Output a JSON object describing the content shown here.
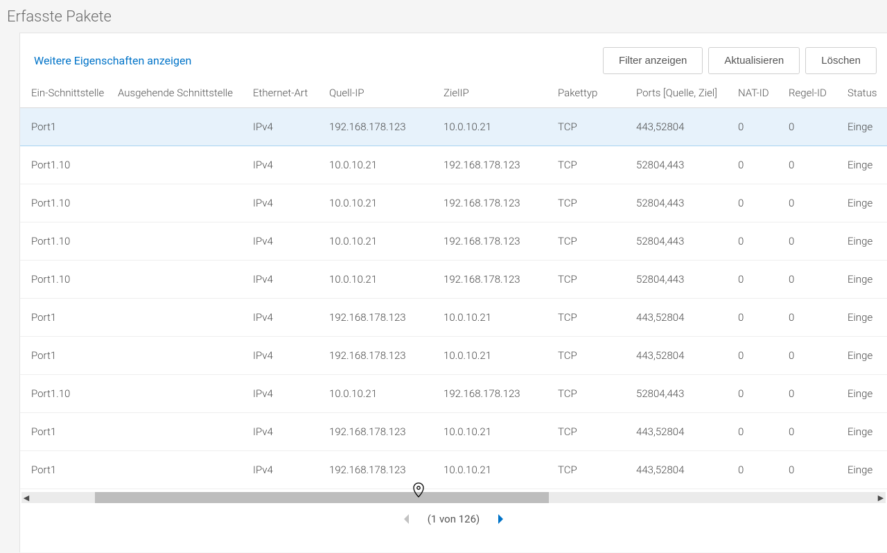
{
  "title": "Erfasste Pakete",
  "toolbar": {
    "more_props_link": "Weitere Eigenschaften anzeigen",
    "show_filter_btn": "Filter anzeigen",
    "refresh_btn": "Aktualisieren",
    "delete_btn": "Löschen"
  },
  "columns": [
    "Ein-Schnittstelle",
    "Ausgehende Schnittstelle",
    "Ethernet-Art",
    "Quell-IP",
    "ZielIP",
    "Pakettyp",
    "Ports [Quelle, Ziel]",
    "NAT-ID",
    "Regel-ID",
    "Status"
  ],
  "rows": [
    {
      "in": "Port1",
      "out": "",
      "eth": "IPv4",
      "src": "192.168.178.123",
      "dst": "10.0.10.21",
      "ptype": "TCP",
      "ports": "443,52804",
      "nat": "0",
      "rule": "0",
      "status": "Einge"
    },
    {
      "in": "Port1.10",
      "out": "",
      "eth": "IPv4",
      "src": "10.0.10.21",
      "dst": "192.168.178.123",
      "ptype": "TCP",
      "ports": "52804,443",
      "nat": "0",
      "rule": "0",
      "status": "Einge"
    },
    {
      "in": "Port1.10",
      "out": "",
      "eth": "IPv4",
      "src": "10.0.10.21",
      "dst": "192.168.178.123",
      "ptype": "TCP",
      "ports": "52804,443",
      "nat": "0",
      "rule": "0",
      "status": "Einge"
    },
    {
      "in": "Port1.10",
      "out": "",
      "eth": "IPv4",
      "src": "10.0.10.21",
      "dst": "192.168.178.123",
      "ptype": "TCP",
      "ports": "52804,443",
      "nat": "0",
      "rule": "0",
      "status": "Einge"
    },
    {
      "in": "Port1.10",
      "out": "",
      "eth": "IPv4",
      "src": "10.0.10.21",
      "dst": "192.168.178.123",
      "ptype": "TCP",
      "ports": "52804,443",
      "nat": "0",
      "rule": "0",
      "status": "Einge"
    },
    {
      "in": "Port1",
      "out": "",
      "eth": "IPv4",
      "src": "192.168.178.123",
      "dst": "10.0.10.21",
      "ptype": "TCP",
      "ports": "443,52804",
      "nat": "0",
      "rule": "0",
      "status": "Einge"
    },
    {
      "in": "Port1",
      "out": "",
      "eth": "IPv4",
      "src": "192.168.178.123",
      "dst": "10.0.10.21",
      "ptype": "TCP",
      "ports": "443,52804",
      "nat": "0",
      "rule": "0",
      "status": "Einge"
    },
    {
      "in": "Port1.10",
      "out": "",
      "eth": "IPv4",
      "src": "10.0.10.21",
      "dst": "192.168.178.123",
      "ptype": "TCP",
      "ports": "52804,443",
      "nat": "0",
      "rule": "0",
      "status": "Einge"
    },
    {
      "in": "Port1",
      "out": "",
      "eth": "IPv4",
      "src": "192.168.178.123",
      "dst": "10.0.10.21",
      "ptype": "TCP",
      "ports": "443,52804",
      "nat": "0",
      "rule": "0",
      "status": "Einge"
    },
    {
      "in": "Port1",
      "out": "",
      "eth": "IPv4",
      "src": "192.168.178.123",
      "dst": "10.0.10.21",
      "ptype": "TCP",
      "ports": "443,52804",
      "nat": "0",
      "rule": "0",
      "status": "Einge"
    }
  ],
  "pagination": {
    "label": "(1 von 126)"
  }
}
